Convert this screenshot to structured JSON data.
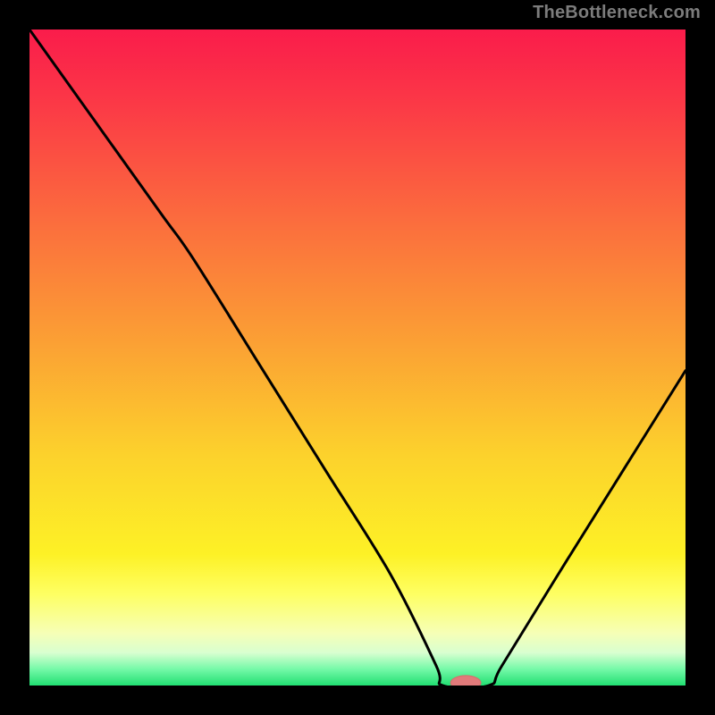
{
  "attribution": "TheBottleneck.com",
  "colors": {
    "curve": "#000000",
    "marker_fill": "#e17a7a",
    "marker_stroke": "#d86a6a",
    "bg_top": "#fa1c4b",
    "bg_bottom": "#21df72"
  },
  "chart_data": {
    "type": "line",
    "title": "",
    "xlabel": "",
    "ylabel": "",
    "xlim": [
      0,
      100
    ],
    "ylim": [
      0,
      100
    ],
    "series": [
      {
        "name": "bottleneck-curve",
        "x": [
          0,
          10,
          20,
          25,
          35,
          45,
          55,
          62,
          63,
          70,
          72,
          80,
          90,
          100
        ],
        "values": [
          100,
          86,
          72,
          65,
          49,
          33,
          17,
          3,
          0,
          0,
          3,
          16,
          32,
          48
        ]
      }
    ],
    "marker": {
      "x": 66.5,
      "y": 0,
      "rx": 2.3,
      "ry": 1.1
    },
    "gradient_stops": [
      {
        "pos": 0,
        "color": "#fa1c4b"
      },
      {
        "pos": 30,
        "color": "#fb6f3d"
      },
      {
        "pos": 65,
        "color": "#fcd22c"
      },
      {
        "pos": 86,
        "color": "#feff62"
      },
      {
        "pos": 95,
        "color": "#d9ffd0"
      },
      {
        "pos": 100,
        "color": "#21df72"
      }
    ]
  }
}
